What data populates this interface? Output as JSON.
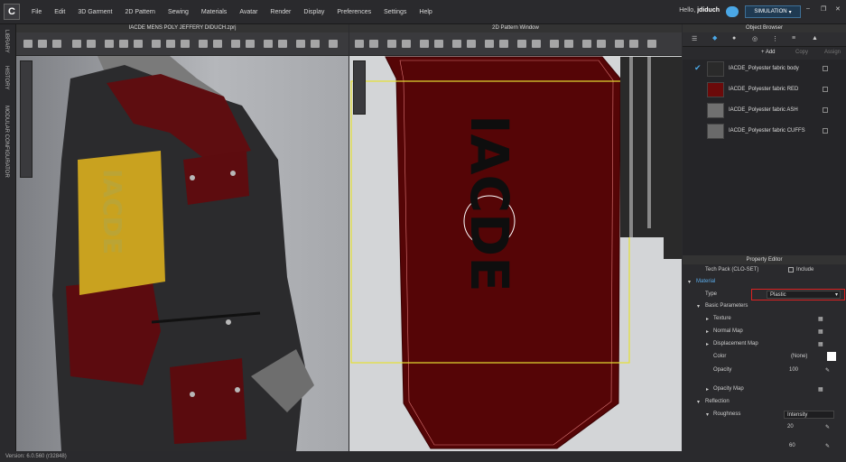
{
  "app": {
    "logo": "C"
  },
  "menu": [
    "File",
    "Edit",
    "3D Garment",
    "2D Pattern",
    "Sewing",
    "Materials",
    "Avatar",
    "Render",
    "Display",
    "Preferences",
    "Settings",
    "Help"
  ],
  "user": {
    "greeting": "Hello,",
    "name": "jdiduch"
  },
  "simulation_label": "SIMULATION",
  "sidebar": {
    "library": "LIBRARY",
    "history": "HISTORY",
    "modular": "MODULAR CONFIGURATOR"
  },
  "viewport3d": {
    "title": "IACDE MENS POLY JEFFERY DIDUCH.zprj",
    "patch_text": "IACDE"
  },
  "viewport2d": {
    "title": "2D Pattern Window",
    "pattern_text": "IACDE"
  },
  "object_browser": {
    "title": "Object Browser",
    "add": "+ Add",
    "copy": "Copy",
    "assign": "Assign",
    "materials": [
      {
        "name": "IACDE_Polyester fabric body",
        "color": "#2a2a2a",
        "checked": true
      },
      {
        "name": "IACDE_Polyester fabric RED",
        "color": "#6b0a0a",
        "checked": false
      },
      {
        "name": "IACDE_Polyester fabric ASH",
        "color": "#707070",
        "checked": false
      },
      {
        "name": "IACDE_Polyester fabric CUFFS",
        "color": "#6a6a6a",
        "checked": false
      }
    ]
  },
  "property_editor": {
    "title": "Property Editor",
    "tech_pack": "Tech Pack (CLO-SET)",
    "include": "Include",
    "material": "Material",
    "type_label": "Type",
    "type_value": "Plastic",
    "basic_parameters": "Basic Parameters",
    "texture": "Texture",
    "normal_map": "Normal Map",
    "displacement_map": "Displacement Map",
    "color": "Color",
    "color_value": "(None)",
    "opacity": "Opacity",
    "opacity_value": "100",
    "opacity_map": "Opacity Map",
    "reflection": "Reflection",
    "roughness": "Roughness",
    "roughness_mode": "Intensity",
    "roughness_value": "20",
    "value_60": "60"
  },
  "status": "Version: 6.0.560 (r32848)"
}
